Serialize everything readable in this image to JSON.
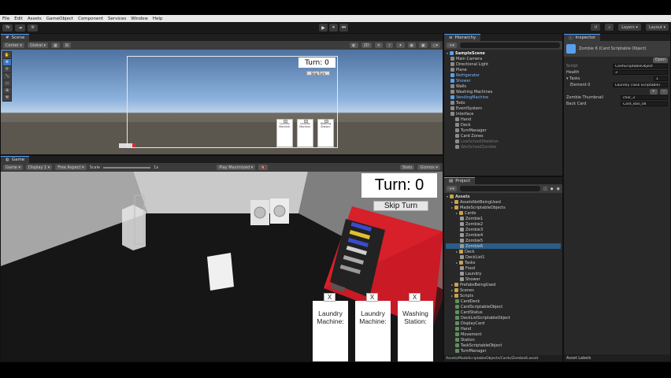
{
  "menu": [
    "File",
    "Edit",
    "Assets",
    "GameObject",
    "Component",
    "Services",
    "Window",
    "Help"
  ],
  "toolbar": {
    "account": "Ye",
    "play_icons": [
      "▶",
      "⏸",
      "⏭"
    ],
    "layers_label": "Layers",
    "layout_label": "Layout"
  },
  "scene": {
    "tab_label": "Scene",
    "toolbar": [
      "Center",
      "Global"
    ],
    "turn_label": "Turn: 0",
    "skip_label": "Skip Turn",
    "cards": [
      "Laundry Machine:",
      "Laundry Machine:",
      "Washing Station:"
    ],
    "card_x": "X"
  },
  "game": {
    "tab_label": "Game",
    "toolbar": [
      "Game",
      "Display 1",
      "Free Aspect",
      "Scale",
      "1x",
      "Play Maximized",
      "Stats",
      "Gizmos"
    ],
    "turn_label": "Turn: 0",
    "skip_label": "Skip Turn",
    "card_x": "X",
    "cards": [
      "Laundry Machine:",
      "Laundry Machine:",
      "Washing Station:"
    ]
  },
  "hierarchy": {
    "tab_label": "Hierarchy",
    "scene_name": "SampleScene",
    "items": [
      {
        "label": "Main Camera",
        "depth": 1,
        "kind": "normal"
      },
      {
        "label": "Directional Light",
        "depth": 1,
        "kind": "normal"
      },
      {
        "label": "Plane",
        "depth": 1,
        "kind": "normal"
      },
      {
        "label": "Refrigerator",
        "depth": 1,
        "kind": "prefab"
      },
      {
        "label": "Shower",
        "depth": 1,
        "kind": "prefab"
      },
      {
        "label": "Walls",
        "depth": 1,
        "kind": "normal"
      },
      {
        "label": "Washing Machines",
        "depth": 1,
        "kind": "normal"
      },
      {
        "label": "VendingMachine",
        "depth": 1,
        "kind": "prefab"
      },
      {
        "label": "Todo",
        "depth": 1,
        "kind": "normal"
      },
      {
        "label": "EventSystem",
        "depth": 1,
        "kind": "normal"
      },
      {
        "label": "Interface",
        "depth": 1,
        "kind": "normal"
      },
      {
        "label": "Hand",
        "depth": 2,
        "kind": "normal"
      },
      {
        "label": "Deck",
        "depth": 2,
        "kind": "normal"
      },
      {
        "label": "TurnManager",
        "depth": 2,
        "kind": "normal"
      },
      {
        "label": "Card Zones",
        "depth": 2,
        "kind": "normal"
      },
      {
        "label": "LowSchoolSkeleton",
        "depth": 2,
        "kind": "dim"
      },
      {
        "label": "WorSchoolZombie",
        "depth": 2,
        "kind": "dim"
      }
    ]
  },
  "project": {
    "tab_label": "Project",
    "root": "Assets",
    "items": [
      {
        "label": "AssetsNotBeingUsed",
        "depth": 1,
        "kind": "folder"
      },
      {
        "label": "MadeScriptableObjects",
        "depth": 1,
        "kind": "folder"
      },
      {
        "label": "Cards",
        "depth": 2,
        "kind": "folder"
      },
      {
        "label": "Zombie1",
        "depth": 3,
        "kind": "asset"
      },
      {
        "label": "Zombie2",
        "depth": 3,
        "kind": "asset"
      },
      {
        "label": "Zombie3",
        "depth": 3,
        "kind": "asset"
      },
      {
        "label": "Zombie4",
        "depth": 3,
        "kind": "asset"
      },
      {
        "label": "Zombie5",
        "depth": 3,
        "kind": "asset"
      },
      {
        "label": "Zombie6",
        "depth": 3,
        "kind": "asset",
        "selected": true
      },
      {
        "label": "Deck",
        "depth": 2,
        "kind": "folder"
      },
      {
        "label": "DeckList1",
        "depth": 3,
        "kind": "asset"
      },
      {
        "label": "Tasks",
        "depth": 2,
        "kind": "folder"
      },
      {
        "label": "Food",
        "depth": 3,
        "kind": "asset"
      },
      {
        "label": "Laundry",
        "depth": 3,
        "kind": "asset"
      },
      {
        "label": "Shower",
        "depth": 3,
        "kind": "asset"
      },
      {
        "label": "PrefabsBeingUsed",
        "depth": 1,
        "kind": "folder"
      },
      {
        "label": "Scenes",
        "depth": 1,
        "kind": "folder"
      },
      {
        "label": "Scripts",
        "depth": 1,
        "kind": "folder"
      },
      {
        "label": "CardDeck",
        "depth": 2,
        "kind": "script"
      },
      {
        "label": "CardScriptableObject",
        "depth": 2,
        "kind": "script"
      },
      {
        "label": "CardStatus",
        "depth": 2,
        "kind": "script"
      },
      {
        "label": "DeckListScriptableObject",
        "depth": 2,
        "kind": "script"
      },
      {
        "label": "DisplayCard",
        "depth": 2,
        "kind": "script"
      },
      {
        "label": "Hand",
        "depth": 2,
        "kind": "script"
      },
      {
        "label": "Movement",
        "depth": 2,
        "kind": "script"
      },
      {
        "label": "Station",
        "depth": 2,
        "kind": "script"
      },
      {
        "label": "TaskScriptableObject",
        "depth": 2,
        "kind": "script"
      },
      {
        "label": "TurnManager",
        "depth": 2,
        "kind": "script"
      }
    ],
    "path": "Assets/MadeScriptableObjects/Cards/Zombie6.asset"
  },
  "inspector": {
    "tab_label": "Inspector",
    "object_name": "Zombie 6 (Card Scriptable Object)",
    "open_label": "Open",
    "script_label": "Script",
    "script_value": "CardScriptableObject",
    "health_label": "Health",
    "health_value": "3",
    "tasks_label": "Tasks",
    "tasks_count": "1",
    "element0_label": "Element 0",
    "element0_value": "Laundry (Task Scriptable)",
    "thumbnail_label": "Zombie Thumbnail",
    "thumbnail_value": "char_3",
    "back_card_label": "Back Card",
    "back_card_value": "Card_sbsl_04",
    "asset_labels": "Asset Labels"
  }
}
